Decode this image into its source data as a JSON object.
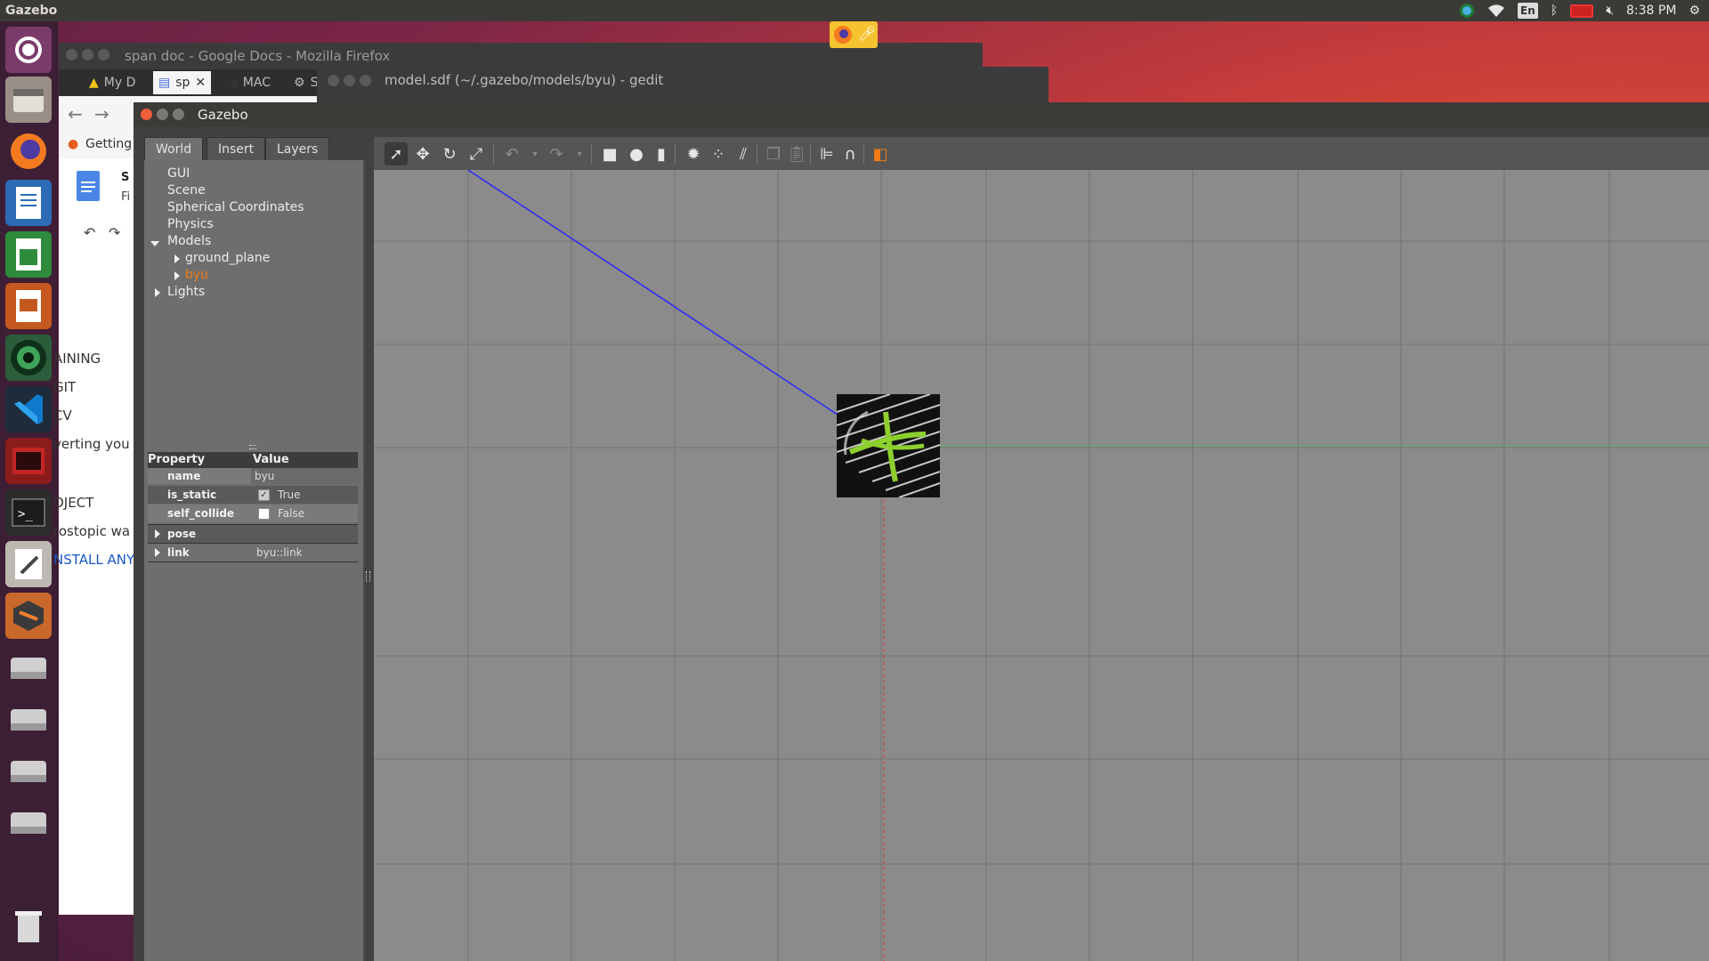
{
  "topbar": {
    "title": "Gazebo",
    "keyboard": "En",
    "time": "8:38 PM"
  },
  "launcher": {
    "items": [
      "ubuntu-dash",
      "files",
      "firefox",
      "writer",
      "calc",
      "impress",
      "camera",
      "vscode",
      "terminal-red",
      "terminal",
      "text-editor",
      "sublime",
      "disk",
      "disk",
      "disk",
      "disk",
      "disk",
      "trash"
    ]
  },
  "firefox": {
    "title": "span doc - Google Docs - Mozilla Firefox",
    "tabs": [
      "My D",
      "sp",
      "MAC",
      "S"
    ],
    "bookmark": "Getting",
    "doc_title_initial": "S",
    "doc_subtitle_initial": "Fi",
    "doc_lines": [
      "AINING",
      "GIT",
      "CV",
      "verting you",
      "OJECT",
      "rostopic wa",
      "NSTALL ANY"
    ]
  },
  "gedit": {
    "title": "model.sdf (~/.gazebo/models/byu) - gedit"
  },
  "gazebo": {
    "title": "Gazebo",
    "tabs": [
      "World",
      "Insert",
      "Layers"
    ],
    "tree": {
      "gui": "GUI",
      "scene": "Scene",
      "spherical": "Spherical Coordinates",
      "physics": "Physics",
      "models": "Models",
      "ground_plane": "ground_plane",
      "byu": "byu",
      "lights": "Lights"
    },
    "properties": {
      "header_property": "Property",
      "header_value": "Value",
      "rows": [
        {
          "key": "name",
          "value": "byu"
        },
        {
          "key": "is_static",
          "value": "True",
          "checked": true
        },
        {
          "key": "self_collide",
          "value": "False",
          "checked": false
        },
        {
          "key": "pose",
          "value": ""
        },
        {
          "key": "link",
          "value": "byu::link"
        }
      ]
    }
  },
  "colors": {
    "accent_orange": "#f07a14",
    "axis_blue": "#2a2aff",
    "axis_red": "#d83a3a",
    "axis_green": "#3cc83c"
  }
}
